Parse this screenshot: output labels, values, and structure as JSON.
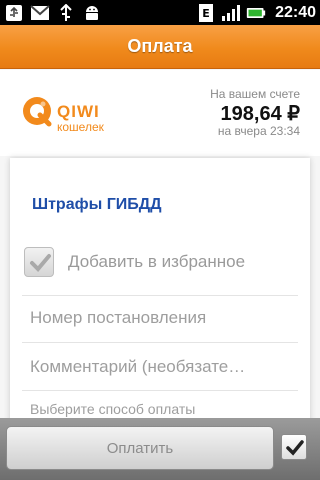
{
  "status_bar": {
    "time": "22:40",
    "left_icons": [
      "usb-icon",
      "gmail-icon",
      "usb-debug-icon",
      "android-icon"
    ],
    "right_icons": [
      "data-network-icon",
      "signal-icon",
      "battery-icon"
    ]
  },
  "header": {
    "title": "Оплата"
  },
  "wallet": {
    "logo_main": "QIWI",
    "logo_sub": "кошелек",
    "balance_caption": "На вашем счете",
    "balance": "198,64 ₽",
    "balance_date": "на вчера 23:34"
  },
  "form": {
    "provider_title": "Штрафы ГИБДД",
    "favorite_label": "Добавить в избранное",
    "favorite_checked": true,
    "fields": [
      {
        "placeholder": "Номер постановления"
      },
      {
        "placeholder": "Комментарий (необязате…"
      }
    ],
    "payment_method_label": "Выберите способ оплаты"
  },
  "footer": {
    "pay_label": "Оплатить",
    "confirm_checked": true
  },
  "colors": {
    "accent": "#f08a1c",
    "title_blue": "#1f4ea8"
  }
}
